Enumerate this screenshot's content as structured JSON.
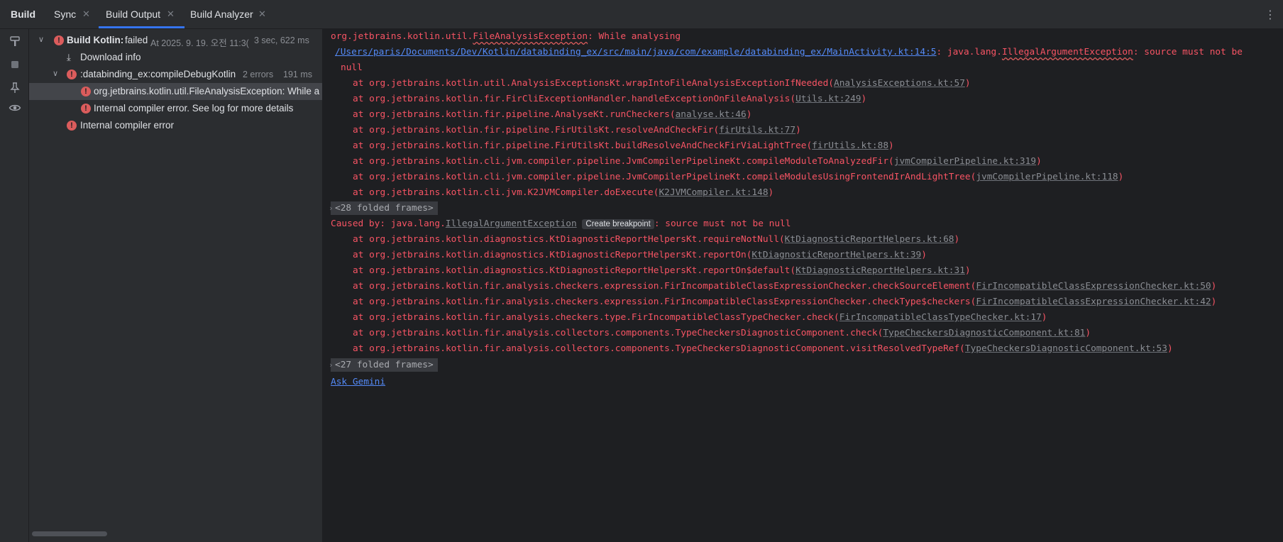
{
  "header": {
    "tool_title": "Build",
    "tabs": [
      {
        "label": "Sync",
        "closable": true
      },
      {
        "label": "Build Output",
        "closable": true,
        "active": true
      },
      {
        "label": "Build Analyzer",
        "closable": true
      }
    ],
    "more_glyph": "⋮"
  },
  "toolstrip": {
    "icons": [
      "hammer-icon",
      "stop-icon",
      "pin-icon",
      "eye-icon"
    ]
  },
  "tree": {
    "rows": [
      {
        "label": "Build Kotlin:",
        "status": "failed",
        "time": "At 2025. 9. 19. 오전 11:3(",
        "duration": "3 sec, 622 ms"
      },
      {
        "label": "Download info"
      },
      {
        "label": ":databinding_ex:compileDebugKotlin",
        "count": "2 errors",
        "duration": "191 ms"
      },
      {
        "label": "org.jetbrains.kotlin.util.FileAnalysisException: While a"
      },
      {
        "label": "Internal compiler error. See log for more details"
      },
      {
        "label": "Internal compiler error"
      }
    ]
  },
  "console": {
    "l1_prefix": "org.jetbrains.kotlin.util.",
    "l1_cls": "FileAnalysisException",
    "l1_rest": ": While analysing",
    "l2_path": "/Users/paris/Documents/Dev/Kotlin/databinding_ex/src/main/java/com/example/databinding_ex/MainActivity.kt:14:5",
    "l2_mid": ": java.lang.",
    "l2_cls": "IllegalArgumentException",
    "l2_rest": ": source must not be",
    "l3": "null",
    "frames1": [
      {
        "text": "at org.jetbrains.kotlin.util.AnalysisExceptionsKt.wrapIntoFileAnalysisExceptionIfNeeded(",
        "link": "AnalysisExceptions.kt:57",
        "tail": ")"
      },
      {
        "text": "at org.jetbrains.kotlin.fir.FirCliExceptionHandler.handleExceptionOnFileAnalysis(",
        "link": "Utils.kt:249",
        "tail": ")"
      },
      {
        "text": "at org.jetbrains.kotlin.fir.pipeline.AnalyseKt.runCheckers(",
        "link": "analyse.kt:46",
        "tail": ")"
      },
      {
        "text": "at org.jetbrains.kotlin.fir.pipeline.FirUtilsKt.resolveAndCheckFir(",
        "link": "firUtils.kt:77",
        "tail": ")"
      },
      {
        "text": "at org.jetbrains.kotlin.fir.pipeline.FirUtilsKt.buildResolveAndCheckFirViaLightTree(",
        "link": "firUtils.kt:88",
        "tail": ")"
      },
      {
        "text": "at org.jetbrains.kotlin.cli.jvm.compiler.pipeline.JvmCompilerPipelineKt.compileModuleToAnalyzedFir(",
        "link": "jvmCompilerPipeline.kt:319",
        "tail": ")"
      },
      {
        "text": "at org.jetbrains.kotlin.cli.jvm.compiler.pipeline.JvmCompilerPipelineKt.compileModulesUsingFrontendIrAndLightTree(",
        "link": "jvmCompilerPipeline.kt:118",
        "tail": ")"
      },
      {
        "text": "at org.jetbrains.kotlin.cli.jvm.K2JVMCompiler.doExecute(",
        "link": "K2JVMCompiler.kt:148",
        "tail": ")"
      }
    ],
    "folded1": "<28 folded frames>",
    "caused_prefix": "Caused by: java.lang.",
    "caused_cls": "IllegalArgumentException",
    "caused_tooltip": "Create breakpoint",
    "caused_rest": ": source must not be null",
    "frames2": [
      {
        "text": "at org.jetbrains.kotlin.diagnostics.KtDiagnosticReportHelpersKt.requireNotNull(",
        "link": "KtDiagnosticReportHelpers.kt:68",
        "tail": ")"
      },
      {
        "text": "at org.jetbrains.kotlin.diagnostics.KtDiagnosticReportHelpersKt.reportOn(",
        "link": "KtDiagnosticReportHelpers.kt:39",
        "tail": ")"
      },
      {
        "text": "at org.jetbrains.kotlin.diagnostics.KtDiagnosticReportHelpersKt.reportOn$default(",
        "link": "KtDiagnosticReportHelpers.kt:31",
        "tail": ")"
      },
      {
        "text": "at org.jetbrains.kotlin.fir.analysis.checkers.expression.FirIncompatibleClassExpressionChecker.checkSourceElement(",
        "link": "FirIncompatibleClassExpressionChecker.kt:50",
        "tail": ")"
      },
      {
        "text": "at org.jetbrains.kotlin.fir.analysis.checkers.expression.FirIncompatibleClassExpressionChecker.checkType$checkers(",
        "link": "FirIncompatibleClassExpressionChecker.kt:42",
        "tail": ")"
      },
      {
        "text": "at org.jetbrains.kotlin.fir.analysis.checkers.type.FirIncompatibleClassTypeChecker.check(",
        "link": "FirIncompatibleClassTypeChecker.kt:17",
        "tail": ")"
      },
      {
        "text": "at org.jetbrains.kotlin.fir.analysis.collectors.components.TypeCheckersDiagnosticComponent.check(",
        "link": "TypeCheckersDiagnosticComponent.kt:81",
        "tail": ")"
      },
      {
        "text": "at org.jetbrains.kotlin.fir.analysis.collectors.components.TypeCheckersDiagnosticComponent.visitResolvedTypeRef(",
        "link": "TypeCheckersDiagnosticComponent.kt:53",
        "tail": ")"
      }
    ],
    "folded2": "<27 folded frames>",
    "ask": "Ask Gemini"
  },
  "colors": {
    "error": "#f75464",
    "accent": "#3574f0",
    "link": "#548af7"
  }
}
